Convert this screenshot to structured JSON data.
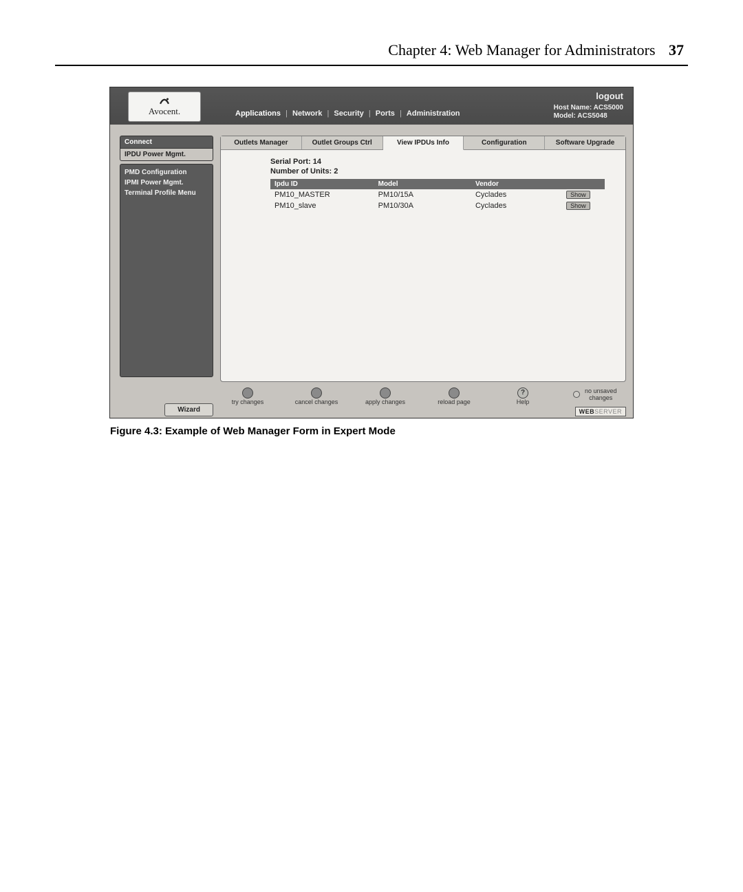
{
  "page": {
    "chapter": "Chapter 4: Web Manager for Administrators",
    "number": "37",
    "caption": "Figure 4.3: Example of Web Manager Form in Expert Mode"
  },
  "app": {
    "brand": "Avocent.",
    "logout": "logout",
    "host_label": "Host Name: ACS5000",
    "model_label": "Model: ACS5048",
    "nav": {
      "applications": "Applications",
      "network": "Network",
      "security": "Security",
      "ports": "Ports",
      "administration": "Administration",
      "sep": "|"
    },
    "sidebar": {
      "connect": "Connect",
      "ipdu": "IPDU Power Mgmt.",
      "items": [
        {
          "label": "PMD Configuration"
        },
        {
          "label": "IPMI Power Mgmt."
        },
        {
          "label": "Terminal Profile Menu"
        }
      ],
      "wizard": "Wizard"
    },
    "subtabs": [
      {
        "label": "Outlets Manager"
      },
      {
        "label": "Outlet Groups Ctrl"
      },
      {
        "label": "View IPDUs Info"
      },
      {
        "label": "Configuration"
      },
      {
        "label": "Software Upgrade"
      }
    ],
    "info": {
      "serial": "Serial Port: 14",
      "units": "Number of Units: 2"
    },
    "table": {
      "headers": {
        "id": "Ipdu ID",
        "model": "Model",
        "vendor": "Vendor"
      },
      "rows": [
        {
          "id": "PM10_MASTER",
          "model": "PM10/15A",
          "vendor": "Cyclades",
          "action": "Show"
        },
        {
          "id": "PM10_slave",
          "model": "PM10/30A",
          "vendor": "Cyclades",
          "action": "Show"
        }
      ]
    },
    "bottom": {
      "try": "try changes",
      "cancel": "cancel changes",
      "apply": "apply changes",
      "reload": "reload page",
      "help": "Help",
      "status": "no unsaved\nchanges",
      "webserver1": "WEB",
      "webserver2": "SERVER"
    }
  }
}
